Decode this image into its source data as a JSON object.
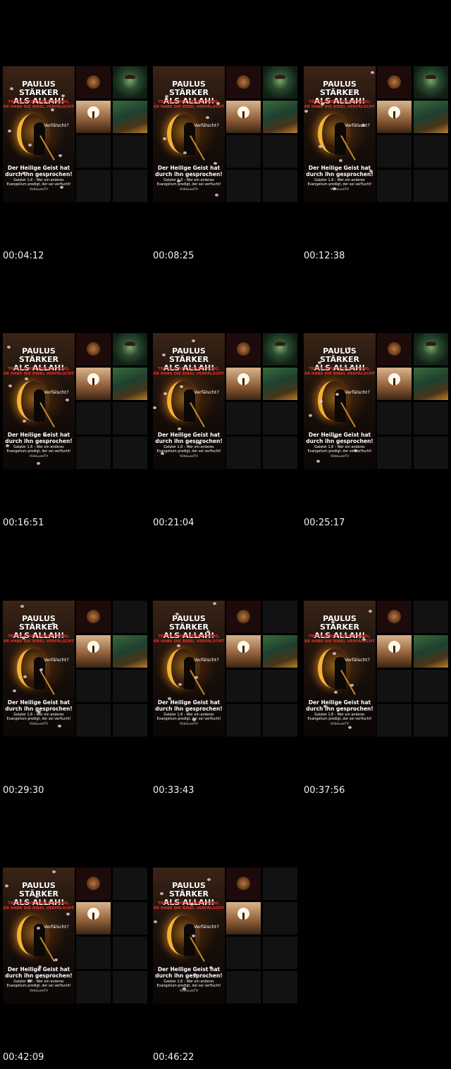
{
  "poster": {
    "title_line1": "PAULUS STÄRKER",
    "title_line2": "ALS ALLAH!",
    "subtitle_line1": "TROTZ IHRER BEHAUPTUNG,",
    "subtitle_line2": "ER HABE DIE BIBEL VERFÄLSCHT",
    "question": "Verfälscht?",
    "headline_line1": "Der Heilige Geist hat",
    "headline_line2": "durch ihn gesprochen!",
    "verse_line1": "Galater 1,8 – Wer ein anderes",
    "verse_line2": "Evangelium predigt, der sei verflucht!",
    "channel": "VideLuxeTV"
  },
  "frames": [
    {
      "timestamp": "00:04:12"
    },
    {
      "timestamp": "00:08:25"
    },
    {
      "timestamp": "00:12:38"
    },
    {
      "timestamp": "00:16:51"
    },
    {
      "timestamp": "00:21:04"
    },
    {
      "timestamp": "00:25:17"
    },
    {
      "timestamp": "00:29:30"
    },
    {
      "timestamp": "00:33:43"
    },
    {
      "timestamp": "00:37:56"
    },
    {
      "timestamp": "00:42:09"
    },
    {
      "timestamp": "00:46:22"
    }
  ]
}
